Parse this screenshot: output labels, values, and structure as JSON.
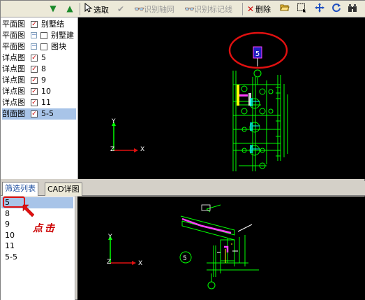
{
  "left_toolbar": {
    "down_icon": "arrow-down-icon",
    "up_icon": "arrow-up-icon"
  },
  "toolbar": {
    "select_label": "选取",
    "identify_axis_label": "识别轴网",
    "identify_mark_label": "识别标记线",
    "delete_label": "删除"
  },
  "tree": {
    "rows": [
      {
        "col1": "平面图",
        "label": "别墅结",
        "checked": true,
        "indent": false
      },
      {
        "col1": "平面图",
        "label": "别墅建",
        "checked": false,
        "indent": true
      },
      {
        "col1": "平面图",
        "label": "图块",
        "checked": false,
        "indent": true
      },
      {
        "col1": "详点图",
        "label": "5",
        "checked": true,
        "indent": false
      },
      {
        "col1": "详点图",
        "label": "8",
        "checked": true,
        "indent": false
      },
      {
        "col1": "详点图",
        "label": "9",
        "checked": true,
        "indent": false
      },
      {
        "col1": "详点图",
        "label": "10",
        "checked": true,
        "indent": false
      },
      {
        "col1": "详点图",
        "label": "11",
        "checked": true,
        "indent": false
      },
      {
        "col1": "剖面图",
        "label": "5-5",
        "checked": true,
        "indent": false
      }
    ]
  },
  "tabs": [
    {
      "label": "筛选列表",
      "active": true
    },
    {
      "label": "CAD详图",
      "active": false
    }
  ],
  "filter_list": [
    "5",
    "8",
    "9",
    "10",
    "11",
    "5-5"
  ],
  "annotation": {
    "text": "点击",
    "color": "#cc0000"
  },
  "canvas_top": {
    "axis_y": "Y",
    "axis_z": "Z",
    "axis_x": "X",
    "tag": "5"
  },
  "canvas_bottom": {
    "axis_y": "Y",
    "axis_z": "Z",
    "axis_x": "X",
    "circle_label": "5"
  }
}
